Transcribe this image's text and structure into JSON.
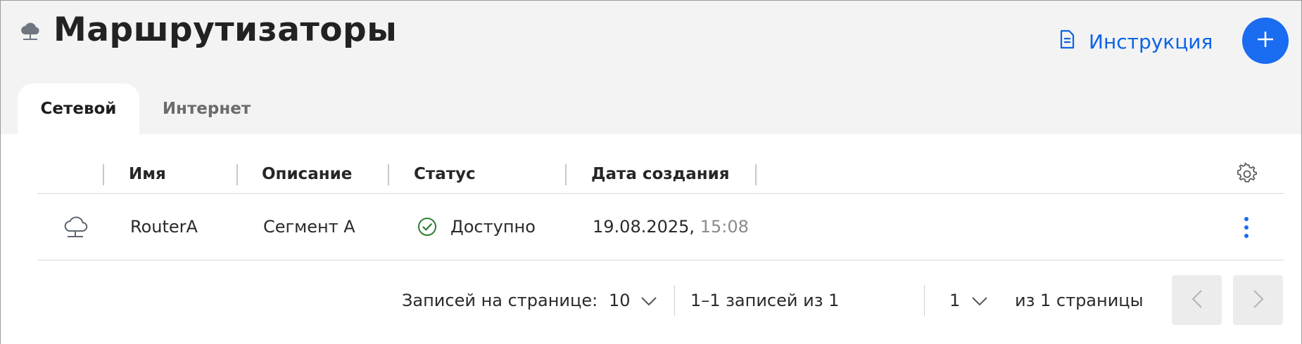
{
  "header": {
    "title": "Маршрутизаторы",
    "title_icon": "cloud-network-icon",
    "guide_label": "Инструкция",
    "add_button_icon": "plus-icon",
    "accent_color": "#1a6cf0"
  },
  "tabs": [
    {
      "label": "Сетевой",
      "active": true
    },
    {
      "label": "Интернет",
      "active": false
    }
  ],
  "table": {
    "columns": [
      "Имя",
      "Описание",
      "Статус",
      "Дата создания"
    ],
    "rows": [
      {
        "icon": "cloud-network-icon",
        "name": "RouterA",
        "description": "Сегмент А",
        "status": "Доступно",
        "status_color": "#2e7d32",
        "date": "19.08.2025,",
        "time": "15:08"
      }
    ]
  },
  "pagination": {
    "per_page_label": "Записей на странице:",
    "per_page_value": "10",
    "range_text": "1–1 записей из 1",
    "page_value": "1",
    "pages_text": "из 1 страницы"
  }
}
